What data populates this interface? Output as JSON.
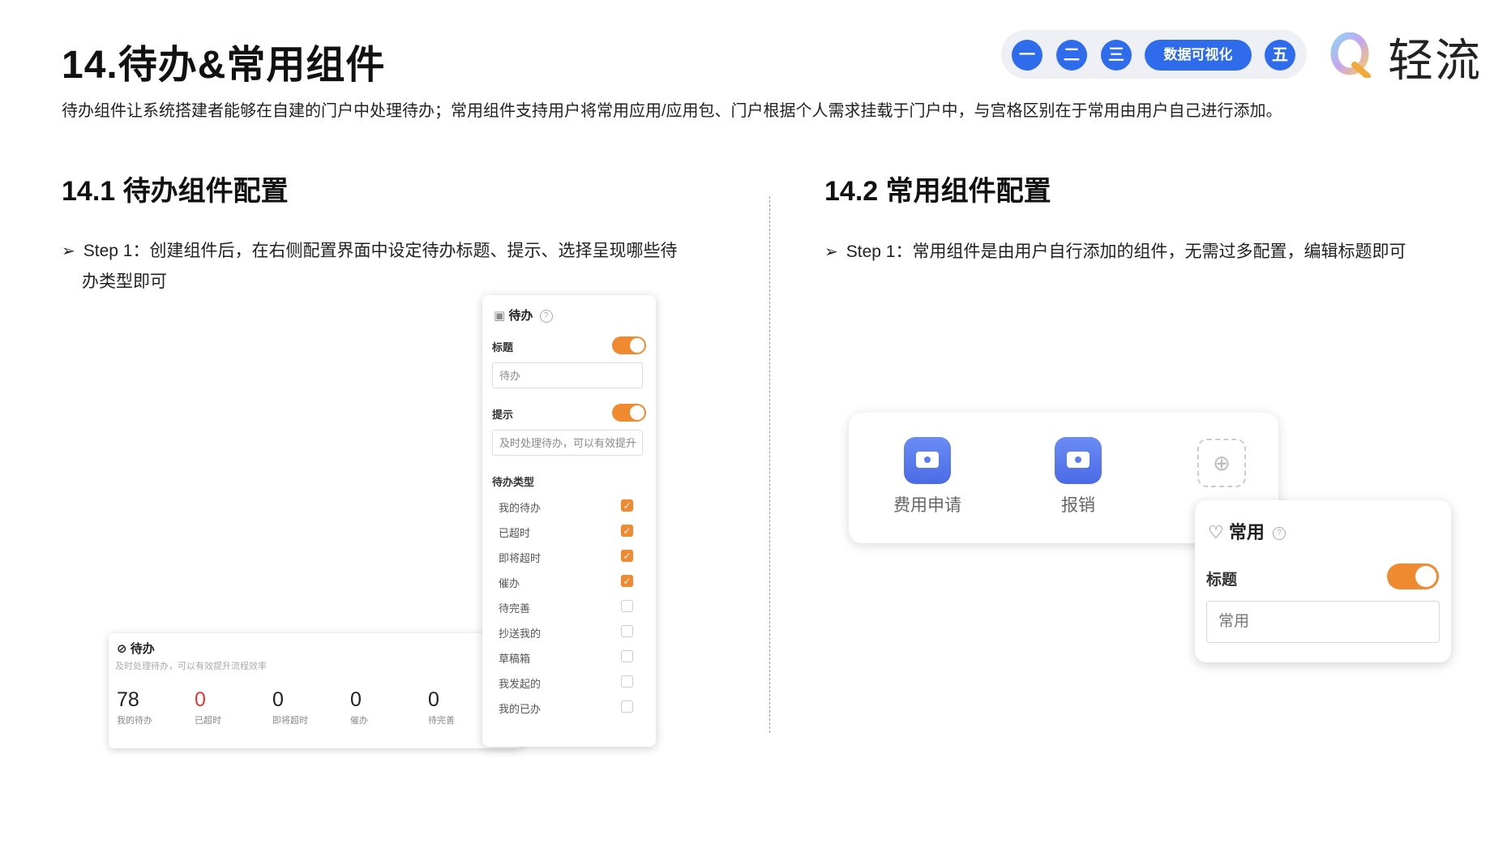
{
  "page": {
    "title": "14.待办&常用组件",
    "intro": "待办组件让系统搭建者能够在自建的门户中处理待办；常用组件支持用户将常用应用/应用包、门户根据个人需求挂载于门户中，与宫格区别在于常用由用户自己进行添加。"
  },
  "nav": {
    "items": [
      "一",
      "二",
      "三",
      "数据可视化",
      "五"
    ],
    "accent": "#2f6cec"
  },
  "logo": {
    "text": "轻流"
  },
  "left": {
    "section_title": "14.1 待办组件配置",
    "step_line1": "Step 1：创建组件后，在右侧配置界面中设定待办标题、提示、选择呈现哪些待",
    "step_line2": "办类型即可",
    "widget": {
      "title": "待办",
      "subtitle": "及时处理待办，可以有效提升流程效率",
      "stats": [
        {
          "value": "78",
          "label": "我的待办",
          "color": "#222222"
        },
        {
          "value": "0",
          "label": "已超时",
          "color": "#e53935"
        },
        {
          "value": "0",
          "label": "即将超时",
          "color": "#222222"
        },
        {
          "value": "0",
          "label": "催办",
          "color": "#222222"
        },
        {
          "value": "0",
          "label": "待完善",
          "color": "#222222"
        }
      ]
    },
    "panel": {
      "header": "待办",
      "title_label": "标题",
      "title_value": "待办",
      "hint_label": "提示",
      "hint_value": "及时处理待办，可以有效提升",
      "types_label": "待办类型",
      "types": [
        {
          "label": "我的待办",
          "checked": true
        },
        {
          "label": "已超时",
          "checked": true
        },
        {
          "label": "即将超时",
          "checked": true
        },
        {
          "label": "催办",
          "checked": true
        },
        {
          "label": "待完善",
          "checked": false
        },
        {
          "label": "抄送我的",
          "checked": false
        },
        {
          "label": "草稿箱",
          "checked": false
        },
        {
          "label": "我发起的",
          "checked": false
        },
        {
          "label": "我的已办",
          "checked": false
        }
      ],
      "toggle_color": "#ef8a31"
    }
  },
  "right": {
    "section_title": "14.2 常用组件配置",
    "step": "Step 1：常用组件是由用户自行添加的组件，无需过多配置，编辑标题即可",
    "apps": [
      {
        "label": "费用申请",
        "icon": "camera-icon"
      },
      {
        "label": "报销",
        "icon": "camera-icon"
      }
    ],
    "card": {
      "header": "常用",
      "title_label": "标题",
      "title_value": "常用"
    }
  }
}
